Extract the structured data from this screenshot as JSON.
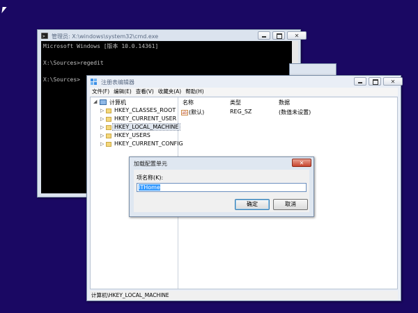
{
  "cmd": {
    "title": "管理员: X:\\windows\\system32\\cmd.exe",
    "lines": [
      "Microsoft Windows [版本 10.0.14361]",
      "",
      "X:\\Sources>regedit",
      "",
      "X:\\Sources>"
    ]
  },
  "regedit": {
    "title": "注册表编辑器",
    "menu": [
      "文件(F)",
      "编辑(E)",
      "查看(V)",
      "收藏夹(A)",
      "帮助(H)"
    ],
    "tree": {
      "root": "计算机",
      "children": [
        "HKEY_CLASSES_ROOT",
        "HKEY_CURRENT_USER",
        "HKEY_LOCAL_MACHINE",
        "HKEY_USERS",
        "HKEY_CURRENT_CONFIG"
      ]
    },
    "columns": {
      "name": "名称",
      "type": "类型",
      "data": "数据"
    },
    "row": {
      "icon": "ab",
      "name": "(默认)",
      "type": "REG_SZ",
      "data": "(数值未设置)"
    },
    "status": "计算机\\HKEY_LOCAL_MACHINE"
  },
  "dialog": {
    "title": "加载配置单元",
    "label": "项名称(K):",
    "value": "ITHome",
    "ok": "确定",
    "cancel": "取消"
  },
  "icons": {
    "cmd": "console-icon",
    "regedit": "registry-icon",
    "computer": "computer-icon",
    "folder": "folder-icon"
  }
}
